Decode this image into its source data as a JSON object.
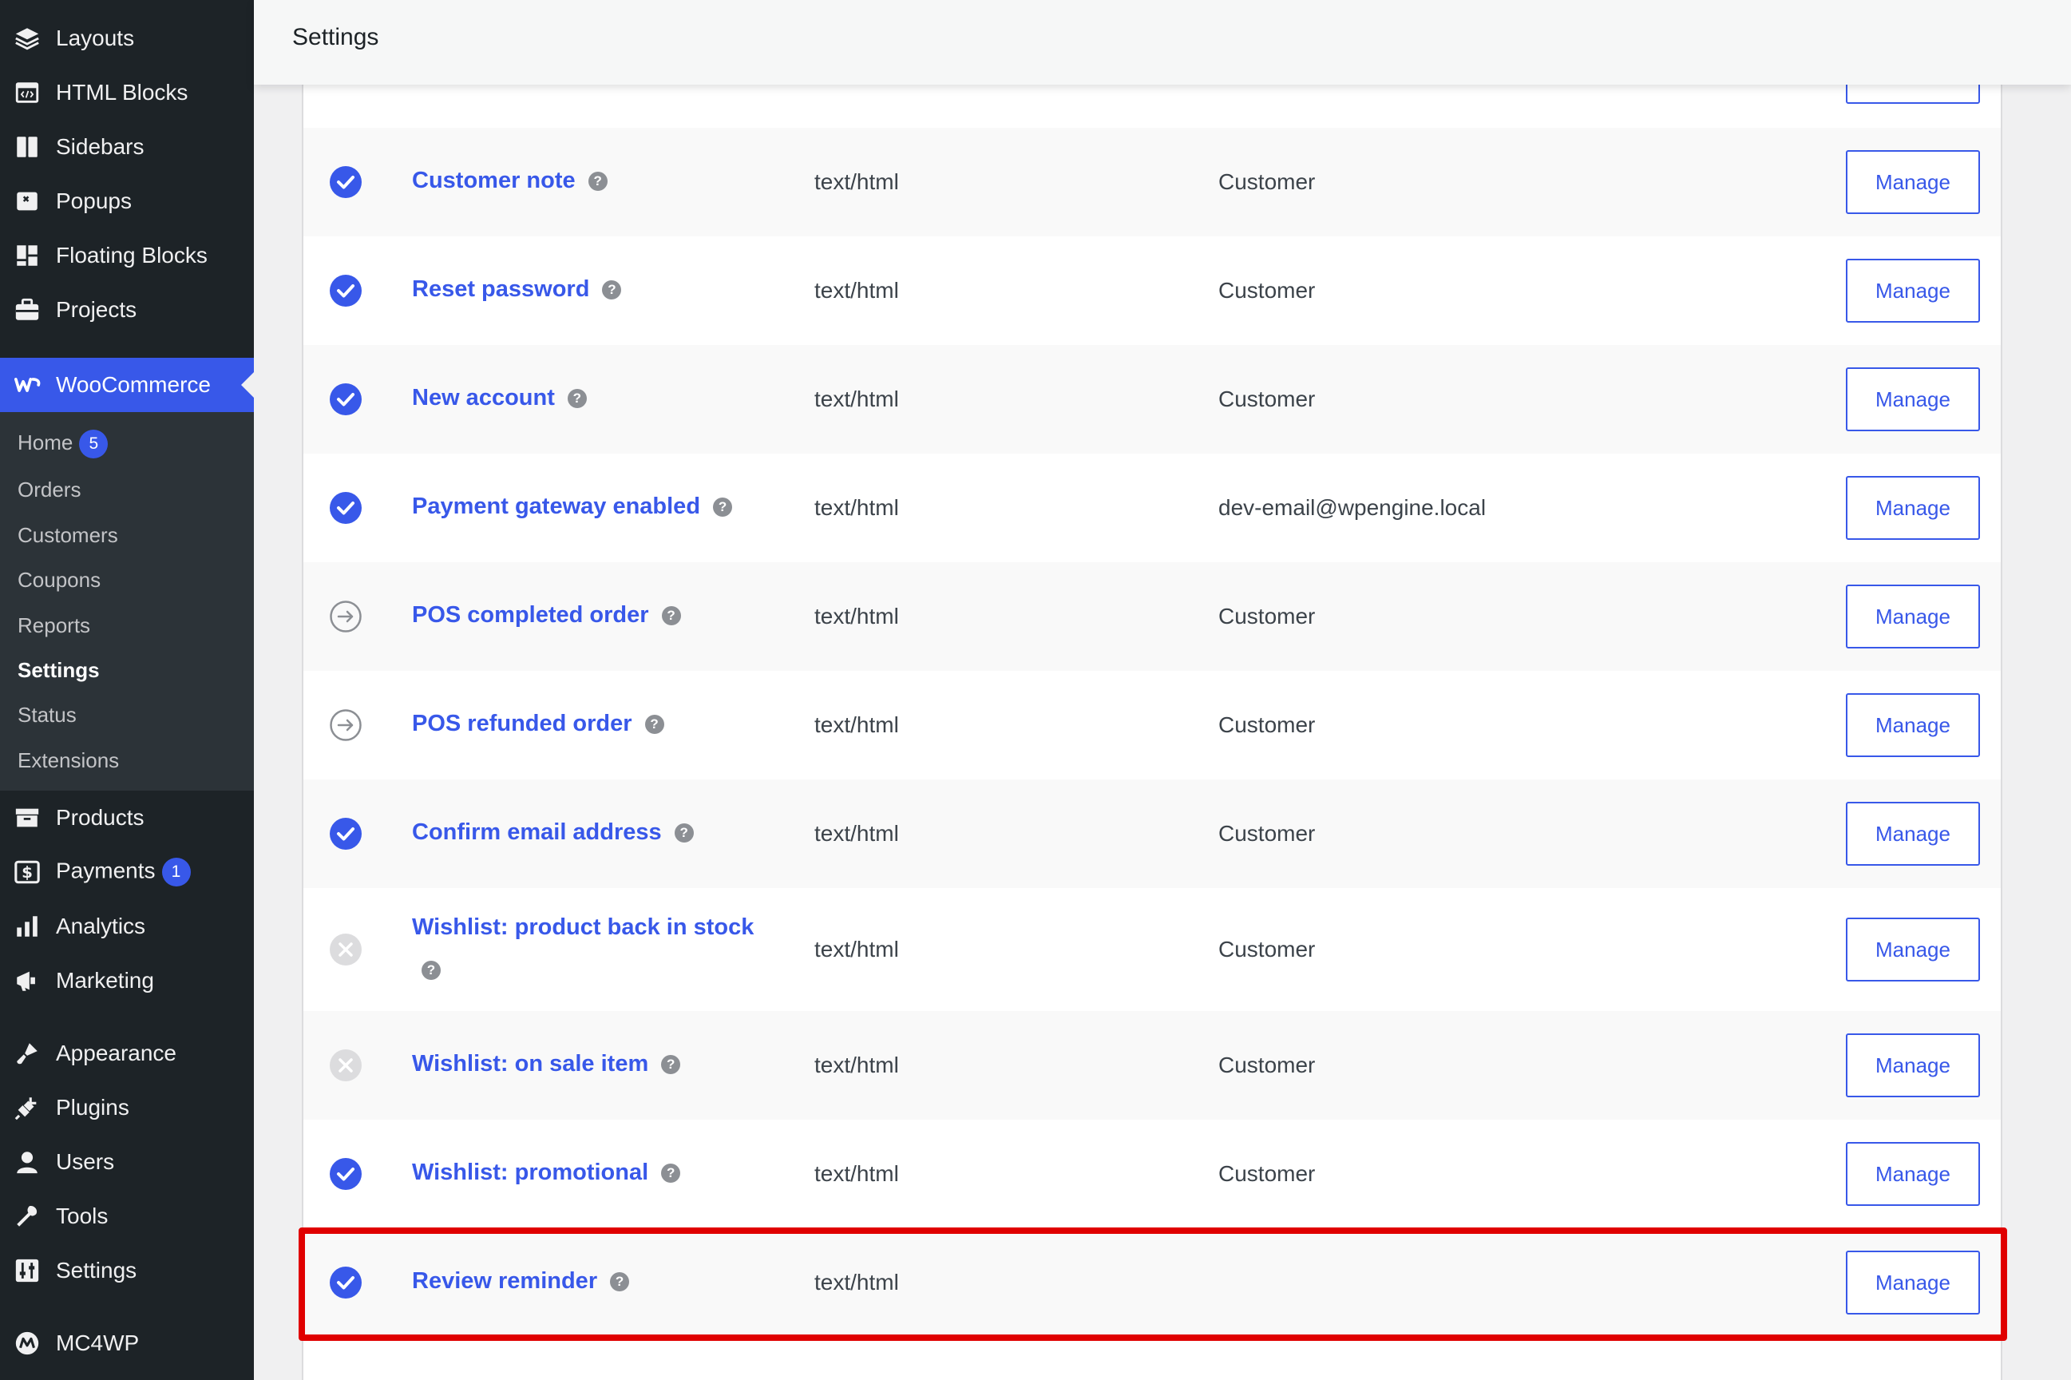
{
  "sidebar": {
    "menu_top": [
      {
        "label": "Layouts",
        "icon": "layers-icon"
      },
      {
        "label": "HTML Blocks",
        "icon": "html-block-icon"
      },
      {
        "label": "Sidebars",
        "icon": "sidebar-icon"
      },
      {
        "label": "Popups",
        "icon": "popup-icon"
      },
      {
        "label": "Floating Blocks",
        "icon": "floating-blocks-icon"
      },
      {
        "label": "Projects",
        "icon": "briefcase-icon"
      }
    ],
    "woocommerce": {
      "label": "WooCommerce",
      "icon": "woocommerce-icon"
    },
    "submenu": [
      {
        "label": "Home",
        "badge": "5"
      },
      {
        "label": "Orders"
      },
      {
        "label": "Customers"
      },
      {
        "label": "Coupons"
      },
      {
        "label": "Reports"
      },
      {
        "label": "Settings"
      },
      {
        "label": "Status"
      },
      {
        "label": "Extensions"
      }
    ],
    "menu_bottom": [
      {
        "label": "Products",
        "icon": "archive-icon"
      },
      {
        "label": "Payments",
        "icon": "payments-icon",
        "badge": "1"
      },
      {
        "label": "Analytics",
        "icon": "bar-chart-icon"
      },
      {
        "label": "Marketing",
        "icon": "megaphone-icon"
      },
      {
        "label": "Appearance",
        "icon": "paintbrush-icon"
      },
      {
        "label": "Plugins",
        "icon": "plug-icon"
      },
      {
        "label": "Users",
        "icon": "user-icon"
      },
      {
        "label": "Tools",
        "icon": "wrench-icon"
      },
      {
        "label": "Settings",
        "icon": "settings-sliders-icon"
      },
      {
        "label": "MC4WP",
        "icon": "mc4wp-icon"
      }
    ]
  },
  "header": {
    "title": "Settings"
  },
  "colors": {
    "accent": "#3858e9",
    "sidebar_bg": "#1d2327",
    "highlight": "#e00000"
  },
  "emails": [
    {
      "title": "Customer note",
      "type": "text/html",
      "recipient": "Customer",
      "status": "enabled",
      "manage": "Manage"
    },
    {
      "title": "Reset password",
      "type": "text/html",
      "recipient": "Customer",
      "status": "enabled",
      "manage": "Manage"
    },
    {
      "title": "New account",
      "type": "text/html",
      "recipient": "Customer",
      "status": "enabled",
      "manage": "Manage"
    },
    {
      "title": "Payment gateway enabled",
      "type": "text/html",
      "recipient": "dev-email@wpengine.local",
      "status": "enabled",
      "manage": "Manage"
    },
    {
      "title": "POS completed order",
      "type": "text/html",
      "recipient": "Customer",
      "status": "manual",
      "manage": "Manage"
    },
    {
      "title": "POS refunded order",
      "type": "text/html",
      "recipient": "Customer",
      "status": "manual",
      "manage": "Manage"
    },
    {
      "title": "Confirm email address",
      "type": "text/html",
      "recipient": "Customer",
      "status": "enabled",
      "manage": "Manage"
    },
    {
      "title": "Wishlist: product back in stock",
      "type": "text/html",
      "recipient": "Customer",
      "status": "disabled",
      "manage": "Manage"
    },
    {
      "title": "Wishlist: on sale item",
      "type": "text/html",
      "recipient": "Customer",
      "status": "disabled",
      "manage": "Manage"
    },
    {
      "title": "Wishlist: promotional",
      "type": "text/html",
      "recipient": "Customer",
      "status": "enabled",
      "manage": "Manage"
    },
    {
      "title": "Review reminder",
      "type": "text/html",
      "recipient": "",
      "status": "enabled",
      "manage": "Manage"
    }
  ],
  "help_glyph": "?"
}
